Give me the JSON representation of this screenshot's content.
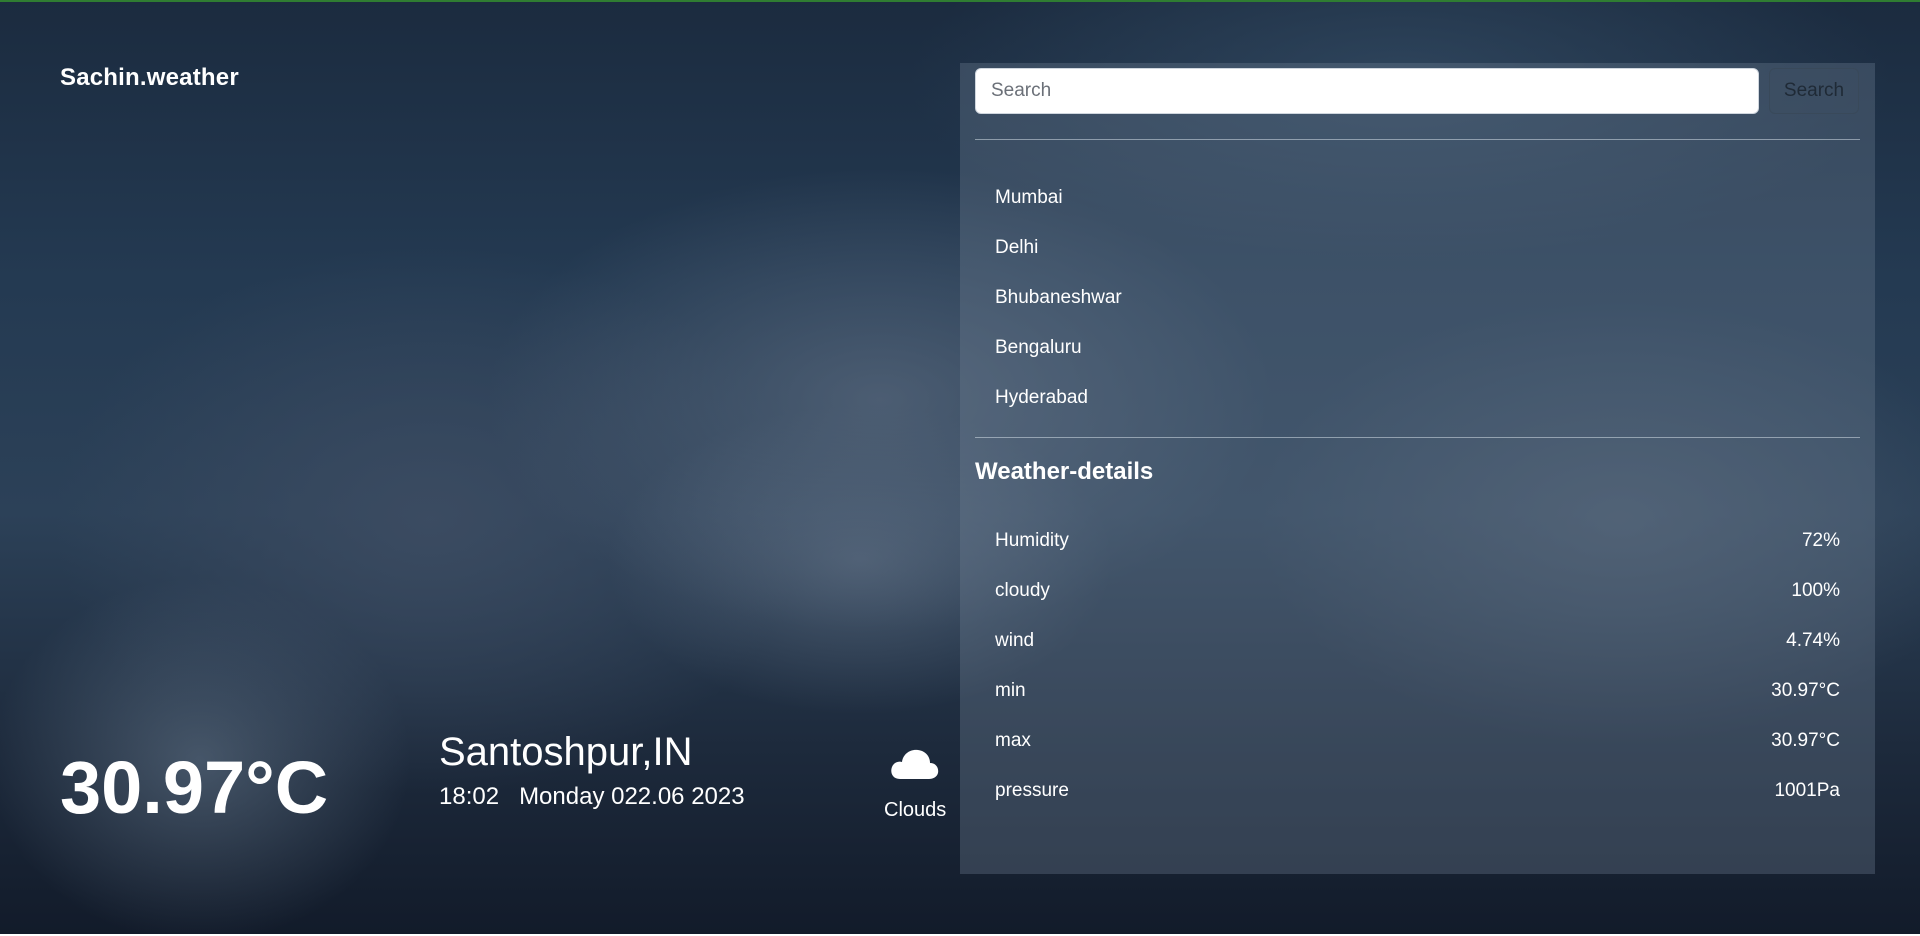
{
  "brand": "Sachin.weather",
  "current": {
    "temperature": "30.97°C",
    "city": "Santoshpur,IN",
    "time": "18:02",
    "date": "Monday 022.06 2023",
    "condition": "Clouds",
    "condition_icon": "cloud-icon"
  },
  "search": {
    "placeholder": "Search",
    "button_label": "Search"
  },
  "cities": [
    "Mumbai",
    "Delhi",
    "Bhubaneshwar",
    "Bengaluru",
    "Hyderabad"
  ],
  "details": {
    "title": "Weather-details",
    "rows": [
      {
        "label": "Humidity",
        "value": "72%"
      },
      {
        "label": "cloudy",
        "value": "100%"
      },
      {
        "label": "wind",
        "value": "4.74%"
      },
      {
        "label": "min",
        "value": "30.97°C"
      },
      {
        "label": "max",
        "value": "30.97°C"
      },
      {
        "label": "pressure",
        "value": "1001Pa"
      }
    ]
  },
  "colors": {
    "accent_line": "#2f7d32",
    "text": "#ffffff"
  }
}
